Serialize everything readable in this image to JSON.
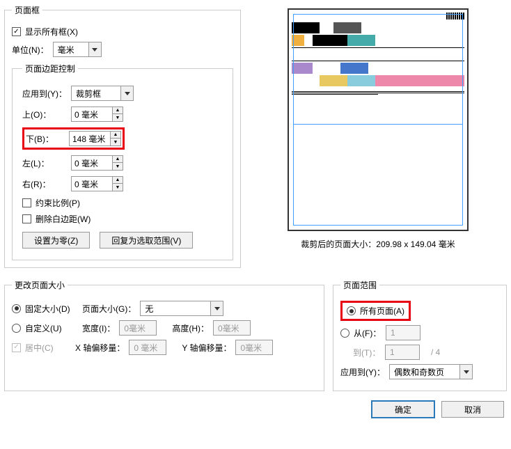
{
  "frame": {
    "legend": "页面框",
    "show_all": "显示所有框(X)",
    "unit_label": "单位(N)：",
    "unit_value": "毫米",
    "margins": {
      "legend": "页面边距控制",
      "apply_to_label": "应用到(Y)：",
      "apply_to_value": "裁剪框",
      "top_label": "上(O)：",
      "top_value": "0 毫米",
      "bottom_label": "下(B)：",
      "bottom_value": "148 毫米",
      "left_label": "左(L)：",
      "left_value": "0 毫米",
      "right_label": "右(R)：",
      "right_value": "0 毫米",
      "constrain": "约束比例(P)",
      "remove_white": "删除白边距(W)",
      "set_zero": "设置为零(Z)",
      "revert": "回复为选取范围(V)"
    }
  },
  "preview": {
    "label": "裁剪后的页面大小：209.98 x 149.04 毫米"
  },
  "resize": {
    "legend": "更改页面大小",
    "fixed": "固定大小(D)",
    "fixed_label": "页面大小(G)：",
    "fixed_value": "无",
    "custom": "自定义(U)",
    "width_label": "宽度(I)：",
    "width_value": "0毫米",
    "height_label": "高度(H)：",
    "height_value": "0毫米",
    "center": "居中(C)",
    "xoff_label": "X 轴偏移量：",
    "xoff_value": "0 毫米",
    "yoff_label": "Y 轴偏移量：",
    "yoff_value": "0毫米"
  },
  "range": {
    "legend": "页面范围",
    "all": "所有页面(A)",
    "from_label": "从(F)：",
    "from_value": "1",
    "to_label": "到(T)：",
    "to_value": "1",
    "total": "/ 4",
    "apply_label": "应用到(Y)：",
    "apply_value": "偶数和奇数页"
  },
  "footer": {
    "ok": "确定",
    "cancel": "取消"
  }
}
